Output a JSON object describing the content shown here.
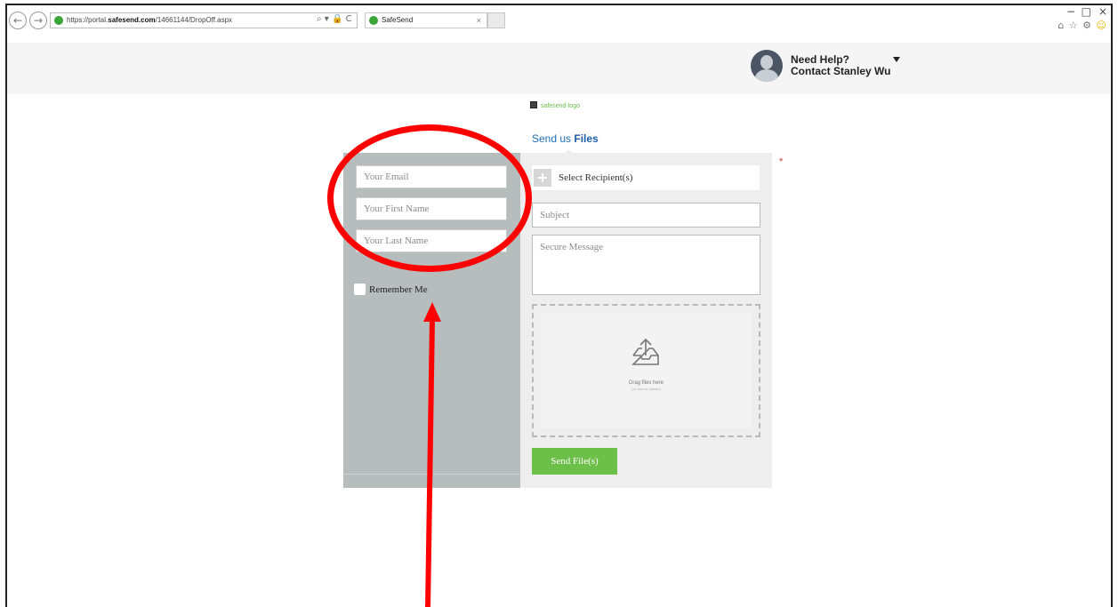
{
  "browser": {
    "back_icon": "arrow-left-icon",
    "forward_icon": "arrow-right-icon",
    "url_prefix": "https://portal.",
    "url_host": "safesend.com",
    "url_path": "/14661144/DropOff.aspx",
    "address_tools": "⌕ ▾ 🔒 C",
    "tab_title": "SafeSend",
    "tab_close": "×",
    "minimize": "−",
    "maximize": "□",
    "close": "×",
    "toolbar_icons": "⌂ ☆ ⚙",
    "smiley": "☺"
  },
  "header": {
    "help_line1": "Need Help?",
    "help_line2": "Contact Stanley Wu"
  },
  "logo": {
    "alt_text": "safesend-logo"
  },
  "title": {
    "prefix": "Send us ",
    "emphasis": "Files"
  },
  "sender_form": {
    "email_placeholder": "Your Email",
    "first_name_placeholder": "Your First Name",
    "last_name_placeholder": "Your Last Name",
    "remember_label": "Remember Me"
  },
  "message_form": {
    "recipients_label": "Select Recipient(s)",
    "required_mark": "*",
    "subject_placeholder": "Subject",
    "message_placeholder": "Secure Message",
    "drop_text": "Drag files here",
    "drop_subtext": "(or click to upload)",
    "send_label": "Send File(s)"
  },
  "colors": {
    "accent_green": "#6cc04a",
    "link_blue": "#1d6fb8",
    "annotation_red": "#ff0000",
    "left_panel": "#b7bcbc"
  }
}
